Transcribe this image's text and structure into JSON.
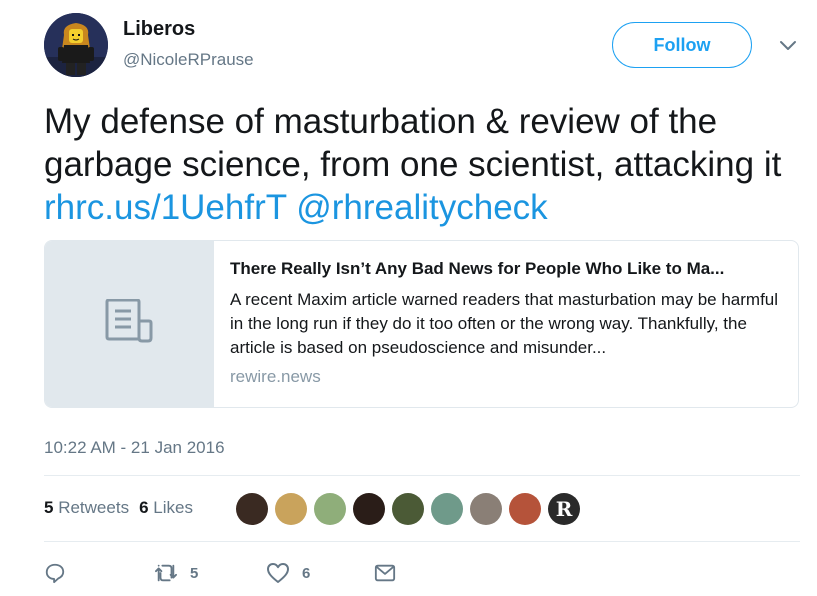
{
  "author": {
    "display_name": "Liberos",
    "screen_name": "@NicoleRPrause"
  },
  "follow_button": {
    "label": "Follow"
  },
  "tweet": {
    "text": "My defense of masturbation & review of the garbage science, from one scientist, attacking it ",
    "link": "rhrc.us/1UehfrT",
    "mention": "@rhrealitycheck"
  },
  "card": {
    "title": "There Really Isn’t Any Bad News for People Who Like to Ma...",
    "description": "A recent Maxim article warned readers that masturbation may be harmful in the long run if they do it too often or the wrong way. Thankfully, the article is based on pseudoscience and misunder...",
    "domain": "rewire.news"
  },
  "timestamp": "10:22 AM - 21 Jan 2016",
  "stats": {
    "retweets_count": "5",
    "retweets_label": "Retweets",
    "likes_count": "6",
    "likes_label": "Likes"
  },
  "likers": [
    {
      "color": "#3a2a22"
    },
    {
      "color": "#c9a35c"
    },
    {
      "color": "#8fae7a"
    },
    {
      "color": "#2a1d18"
    },
    {
      "color": "#4b5a36"
    },
    {
      "color": "#6f9a8a"
    },
    {
      "color": "#8a7f76"
    },
    {
      "color": "#b5533a"
    },
    {
      "color": "#2a2a2a",
      "letter": "R"
    }
  ],
  "actions": {
    "reply_icon": "reply-icon",
    "retweet_icon": "retweet-icon",
    "retweet_count": "5",
    "like_icon": "heart-icon",
    "like_count": "6",
    "dm_icon": "envelope-icon"
  },
  "colors": {
    "accent": "#1da1f2",
    "link": "#1b95e0",
    "muted": "#657786"
  }
}
